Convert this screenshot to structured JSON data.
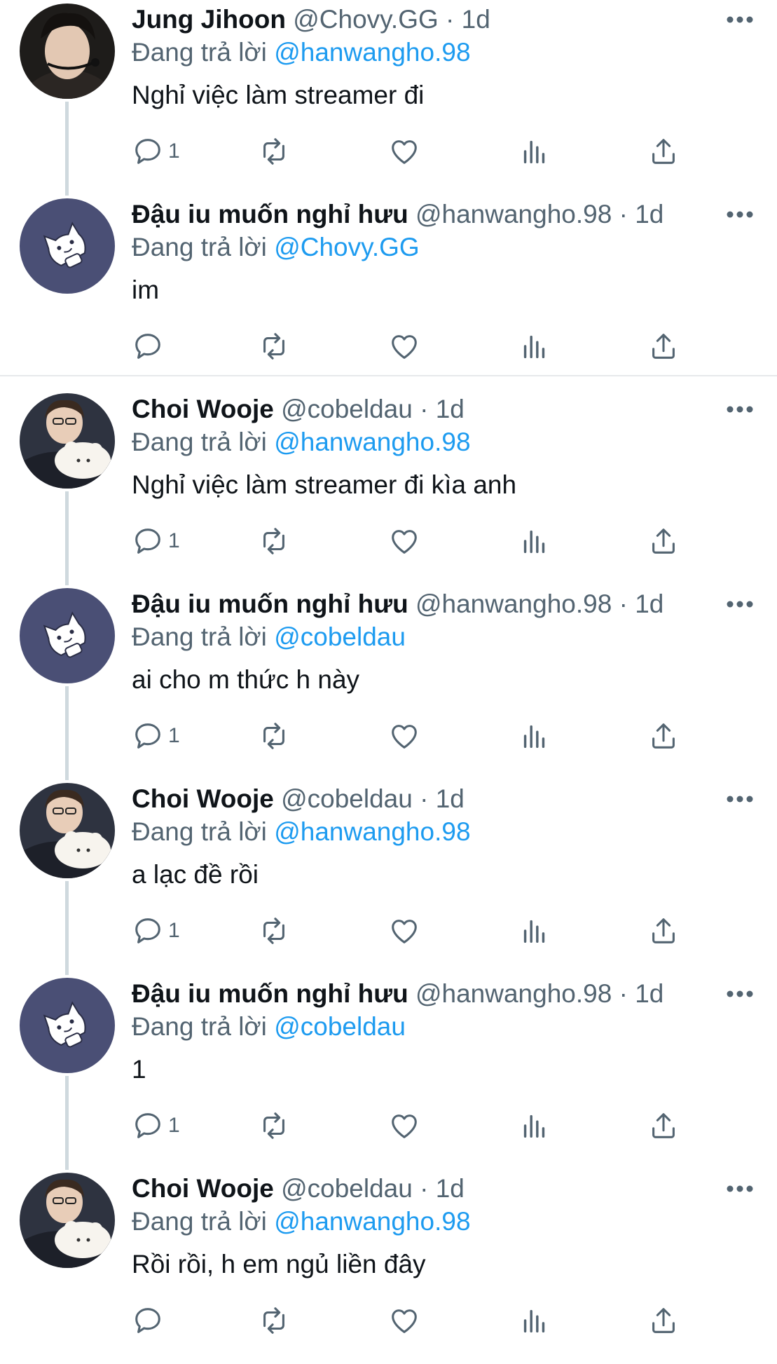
{
  "tweets": [
    {
      "name": "Jung Jihoon",
      "handle": "@Chovy.GG",
      "dot": "·",
      "time": "1d",
      "reply_label": "Đang trả lời",
      "reply_to": "@hanwangho.98",
      "text": "Nghỉ việc làm streamer đi",
      "reply_count": "1",
      "avatar": "chovy"
    },
    {
      "name": "Đậu iu muốn nghỉ hưu",
      "handle": "@hanwangho.98",
      "dot": "·",
      "time": "1d",
      "reply_label": "Đang trả lời",
      "reply_to": "@Chovy.GG",
      "text": "im",
      "reply_count": "",
      "avatar": "cat"
    },
    {
      "name": "Choi Wooje",
      "handle": "@cobeldau",
      "dot": "·",
      "time": "1d",
      "reply_label": "Đang trả lời",
      "reply_to": "@hanwangho.98",
      "text": "Nghỉ việc làm streamer đi kìa anh",
      "reply_count": "1",
      "avatar": "wooje"
    },
    {
      "name": "Đậu iu muốn nghỉ hưu",
      "handle": "@hanwangho.98",
      "dot": "·",
      "time": "1d",
      "reply_label": "Đang trả lời",
      "reply_to": "@cobeldau",
      "text": "ai cho m thức h này",
      "reply_count": "1",
      "avatar": "cat"
    },
    {
      "name": "Choi Wooje",
      "handle": "@cobeldau",
      "dot": "·",
      "time": "1d",
      "reply_label": "Đang trả lời",
      "reply_to": "@hanwangho.98",
      "text": "a lạc đề rồi",
      "reply_count": "1",
      "avatar": "wooje"
    },
    {
      "name": "Đậu iu muốn nghỉ hưu",
      "handle": "@hanwangho.98",
      "dot": "·",
      "time": "1d",
      "reply_label": "Đang trả lời",
      "reply_to": "@cobeldau",
      "text": "1",
      "reply_count": "1",
      "avatar": "cat"
    },
    {
      "name": "Choi Wooje",
      "handle": "@cobeldau",
      "dot": "·",
      "time": "1d",
      "reply_label": "Đang trả lời",
      "reply_to": "@hanwangho.98",
      "text": "Rồi rồi, h em ngủ liền đây",
      "reply_count": "",
      "avatar": "wooje"
    }
  ],
  "icons": {
    "reply": "reply-icon",
    "retweet": "retweet-icon",
    "like": "heart-icon",
    "views": "views-icon",
    "share": "share-icon",
    "more": "more-icon"
  },
  "colors": {
    "link": "#1d9bf0",
    "muted": "#536471",
    "text": "#0f1419",
    "avatar_cat_bg": "#4a4f75"
  }
}
